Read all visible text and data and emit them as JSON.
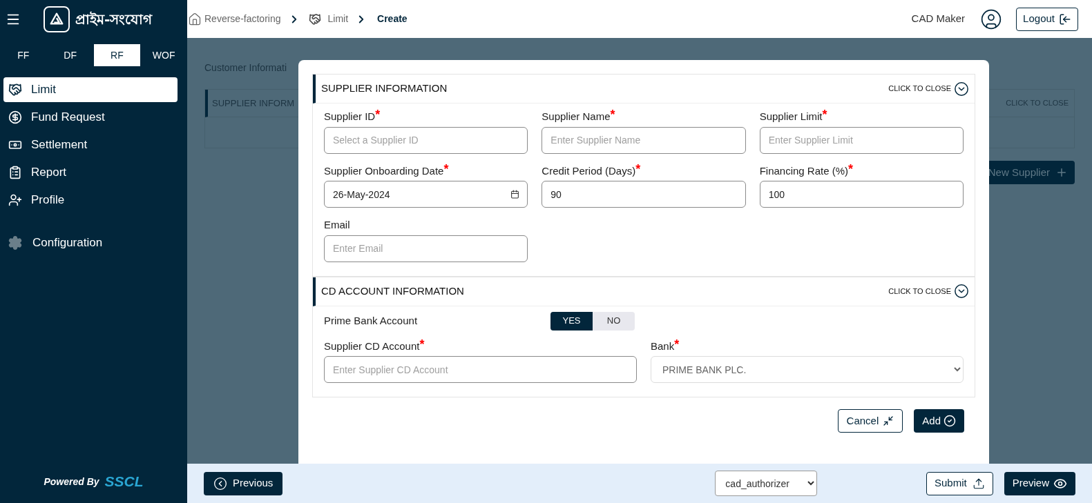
{
  "sidebar": {
    "logo_text": "প্রাইম-সংযোগ",
    "modules": [
      {
        "label": "FF",
        "selected": false
      },
      {
        "label": "DF",
        "selected": false
      },
      {
        "label": "RF",
        "selected": true
      },
      {
        "label": "WOF",
        "selected": false
      }
    ],
    "menu": [
      {
        "label": "Limit",
        "selected": true
      },
      {
        "label": "Fund Request",
        "selected": false
      },
      {
        "label": "Settlement",
        "selected": false
      },
      {
        "label": "Report",
        "selected": false
      },
      {
        "label": "Profile",
        "selected": false
      }
    ],
    "settings_menu": [
      {
        "label": "Configuration",
        "selected": false
      }
    ],
    "powered_by": {
      "label": "Powered By",
      "brand": "SSCL"
    }
  },
  "header": {
    "breadcrumb": [
      {
        "label": "Reverse-factoring",
        "current": false
      },
      {
        "label": "Limit",
        "current": false
      },
      {
        "label": "Create",
        "current": true
      }
    ],
    "user": "CAD Maker",
    "logout": "Logout"
  },
  "background": {
    "title": "Customer Informati",
    "card_title": "SUPPLIER INFORM",
    "close_label": "CLICK TO CLOSE",
    "new_supplier": "New Supplier"
  },
  "modal": {
    "sections": [
      {
        "title": "SUPPLIER INFORMATION",
        "close_label": "CLICK TO CLOSE",
        "fields": [
          {
            "kind": "text",
            "label": "Supplier ID",
            "required_mark": "*",
            "placeholder": "Select a Supplier ID"
          },
          {
            "kind": "text",
            "label": "Supplier Name",
            "required_mark": "*",
            "placeholder": "Enter Supplier Name"
          },
          {
            "kind": "text",
            "label": "Supplier Limit",
            "required_mark": "*",
            "placeholder": "Enter Supplier Limit"
          },
          {
            "kind": "date",
            "label": "Supplier Onboarding Date",
            "required_mark": "*",
            "value": "26-May-2024"
          },
          {
            "kind": "text",
            "label": "Credit Period (Days)",
            "required_mark": "*",
            "value": "90"
          },
          {
            "kind": "text",
            "label": "Financing Rate (%)",
            "required_mark": "*",
            "value": "100"
          },
          {
            "kind": "text",
            "label": "Email",
            "placeholder": "Enter Email"
          }
        ]
      },
      {
        "title": "CD ACCOUNT INFORMATION",
        "close_label": "CLICK TO CLOSE",
        "toggle": {
          "label": "Prime Bank Account",
          "options": [
            {
              "label": "YES",
              "selected": true
            },
            {
              "label": "NO",
              "selected": false
            }
          ]
        },
        "fields": [
          {
            "kind": "text",
            "label": "Supplier CD Account",
            "required_mark": "*",
            "placeholder": "Enter Supplier CD Account"
          },
          {
            "kind": "select",
            "label": "Bank",
            "required_mark": "*",
            "value": "PRIME BANK PLC.",
            "disabled": true
          }
        ]
      }
    ],
    "cancel": "Cancel",
    "add": "Add"
  },
  "footer": {
    "previous": "Previous",
    "role_select": "cad_authorizer",
    "submit": "Submit",
    "preview": "Preview"
  }
}
